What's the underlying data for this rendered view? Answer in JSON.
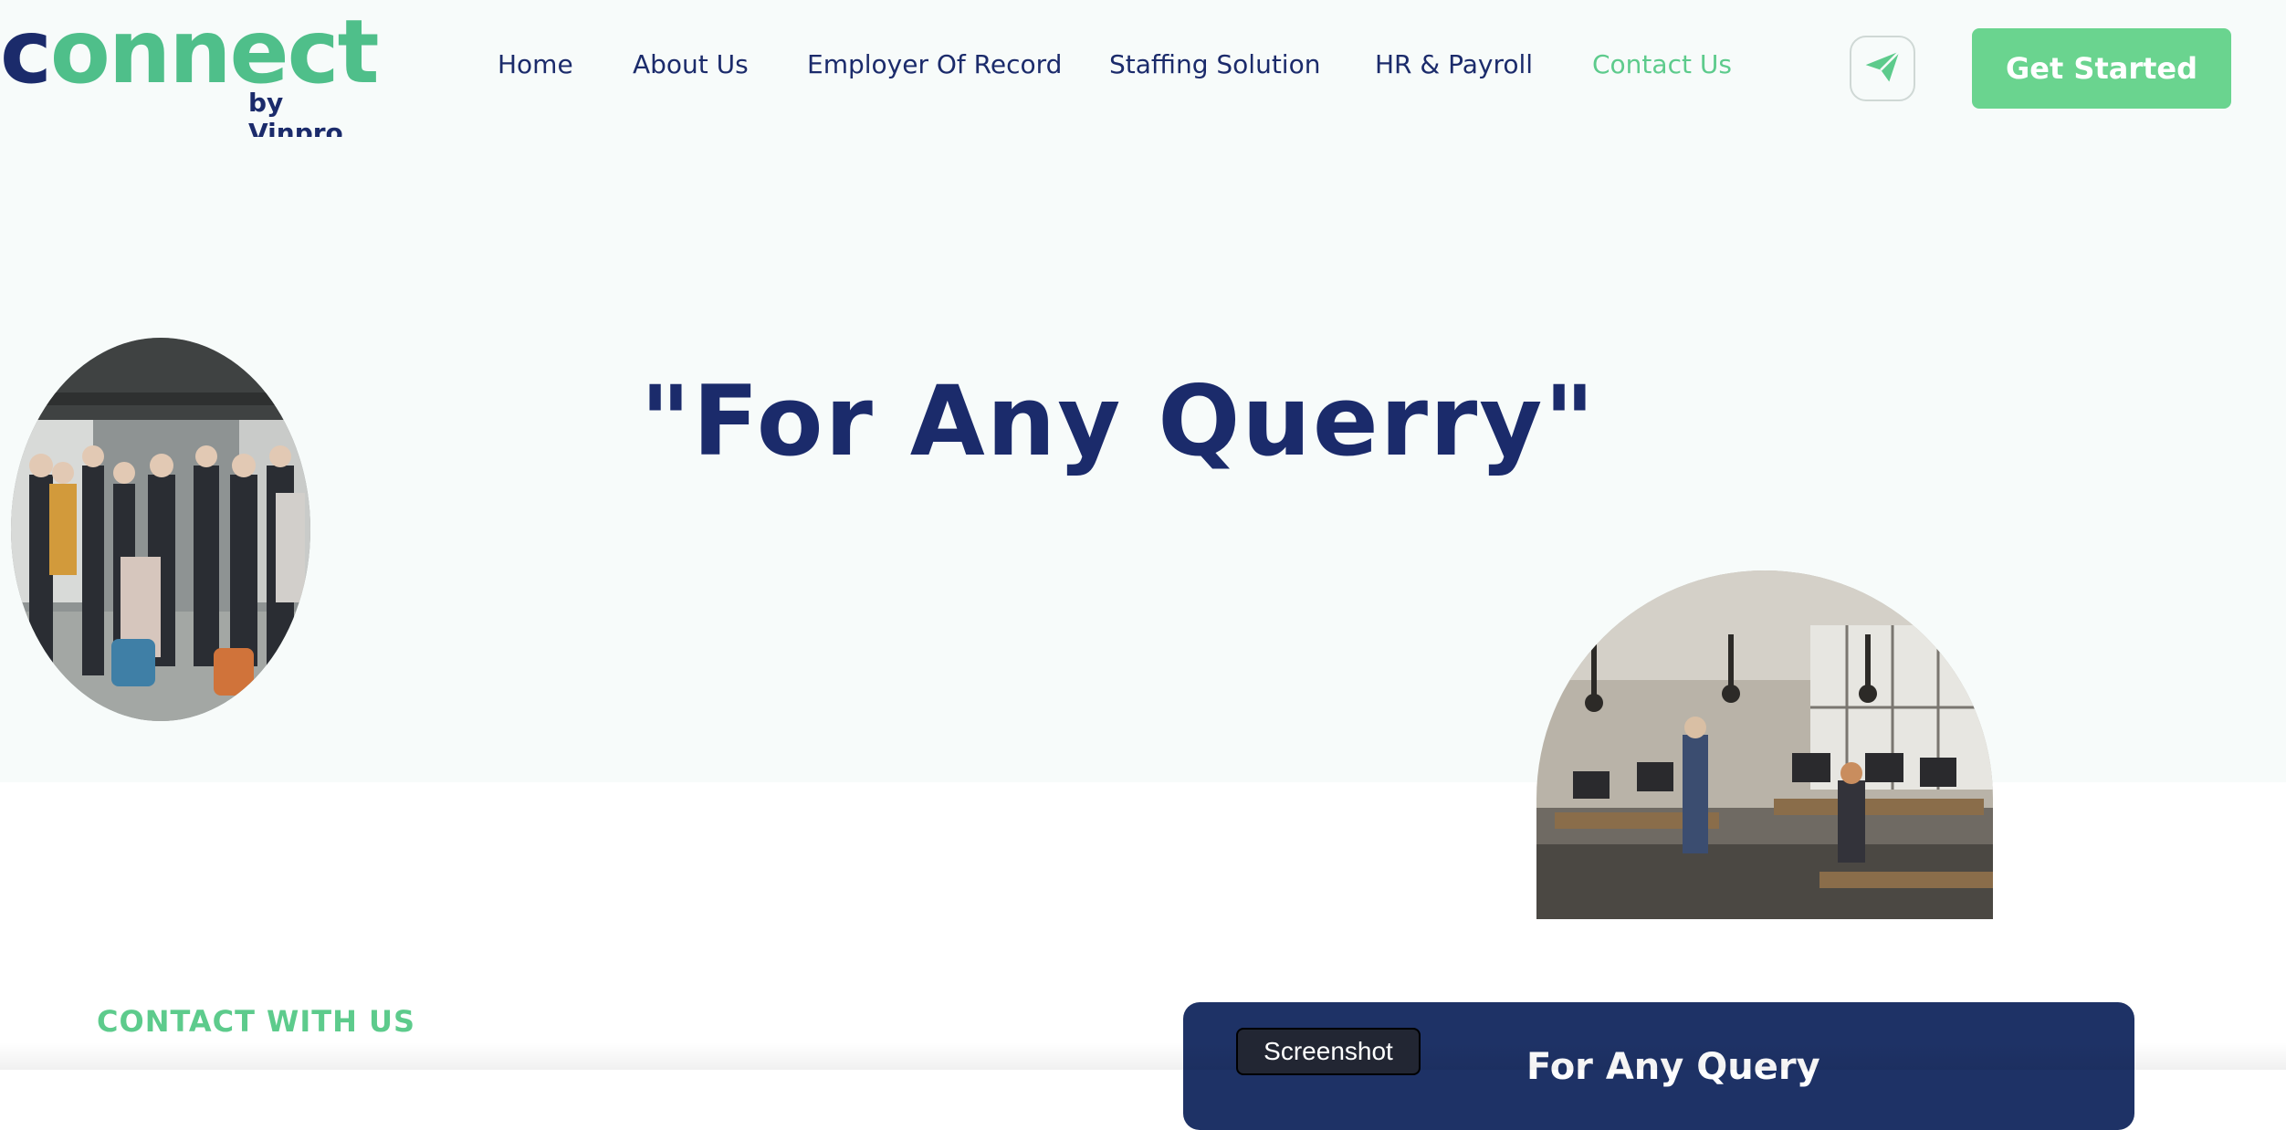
{
  "logo": {
    "word": "connect",
    "first_letter": "c",
    "rest": "onnect",
    "sub": "by Vinpro"
  },
  "nav": {
    "items": [
      {
        "label": "Home"
      },
      {
        "label": "About Us"
      },
      {
        "label": "Employer Of Record"
      },
      {
        "label": "Staffing Solution"
      },
      {
        "label": "HR & Payroll"
      },
      {
        "label": "Contact Us"
      }
    ],
    "active": "Contact Us"
  },
  "header": {
    "icon": "paper-plane-icon",
    "cta_label": "Get Started"
  },
  "hero": {
    "title": "\"For Any Querry\""
  },
  "contact": {
    "eyebrow": "CONTACT WITH US",
    "card_title": "For Any Query"
  },
  "tooltip": {
    "label": "Screenshot"
  },
  "colors": {
    "navy": "#1b2b6b",
    "green": "#5dcb8c",
    "cta_green": "#6ad48f",
    "hero_bg": "#f7fbfa",
    "card_bg": "#1e3266"
  }
}
